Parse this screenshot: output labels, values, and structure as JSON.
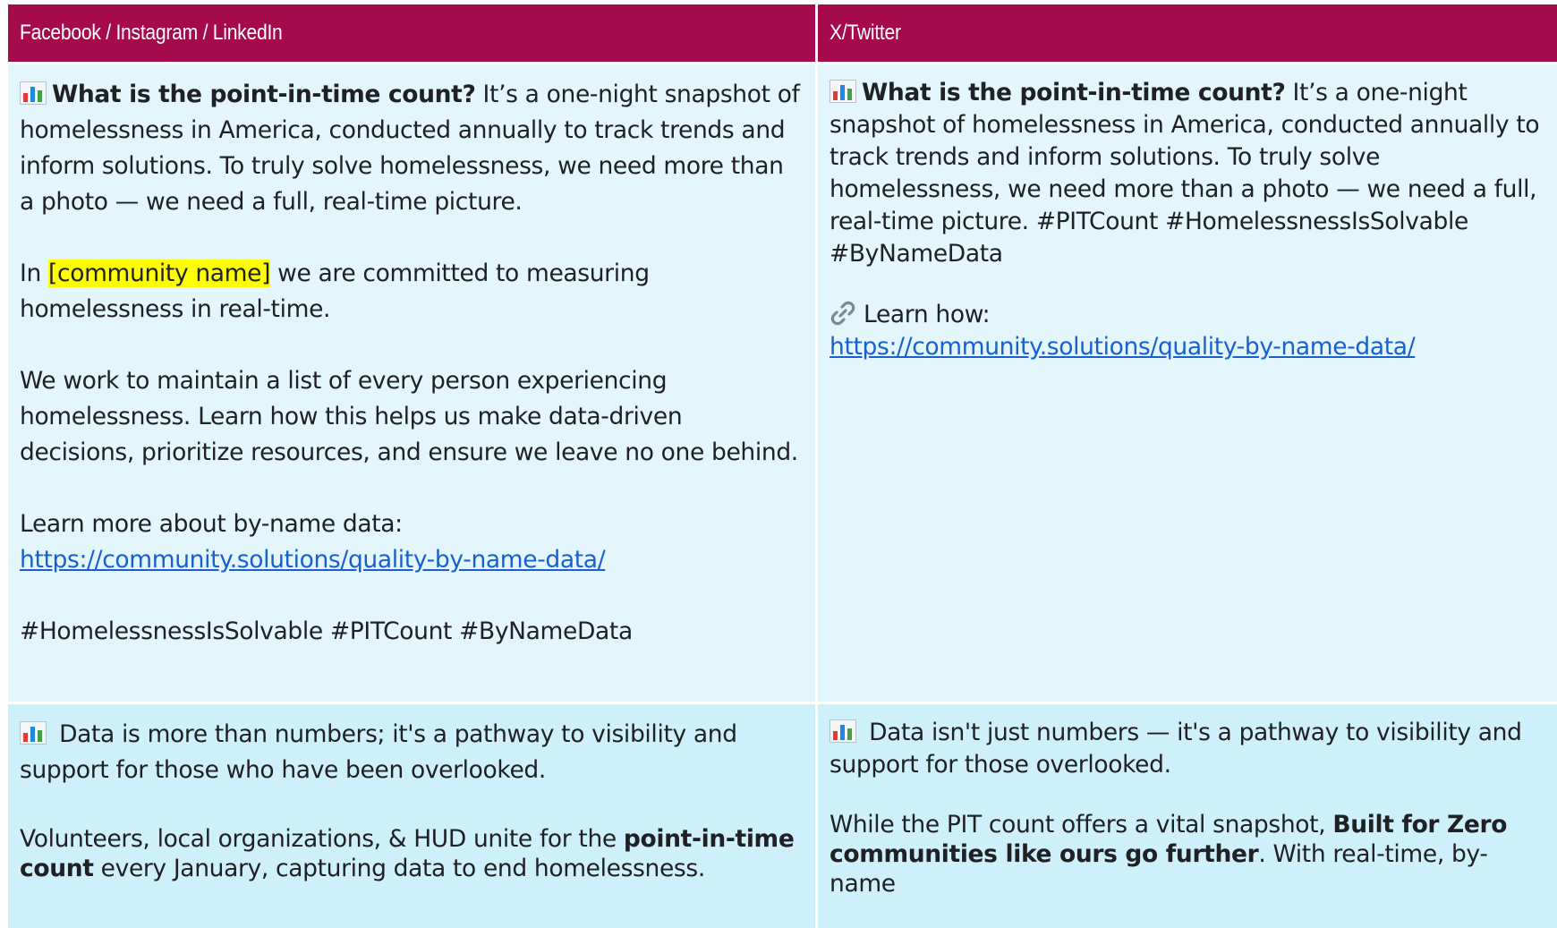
{
  "headers": {
    "left": "Facebook / Instagram / LinkedIn",
    "right": "X/Twitter"
  },
  "row1": {
    "left": {
      "q_bold": "What is the point-in-time count?",
      "q_rest": " It’s a one-night snapshot of homelessness in America, conducted annually to track trends and inform solutions. To truly solve homelessness, we need more than a photo — we need a full, real-time picture.",
      "p2_pre": "In ",
      "p2_placeholder": "[community name]",
      "p2_post": " we are committed to measuring homelessness in real-time.",
      "p3": "We work to maintain a list of every person experiencing homelessness. Learn how this helps us make data-driven decisions, prioritize resources, and ensure we leave no one behind.",
      "p4_label": "Learn more about by-name data:",
      "p4_link": "https://community.solutions/quality-by-name-data/",
      "p5": "#HomelessnessIsSolvable #PITCount #ByNameData"
    },
    "right": {
      "q_bold": "What is the point-in-time count?",
      "q_rest": " It’s a one-night snapshot of homelessness in America, conducted annually to track trends and inform solutions. To truly solve homelessness, we need more than a photo — we need a full, real-time picture. #PITCount #HomelessnessIsSolvable #ByNameData",
      "learn_label": "Learn how:",
      "link": "https://community.solutions/quality-by-name-data/"
    }
  },
  "row2": {
    "left": {
      "p1": " Data is more than numbers; it's a pathway to visibility and support for those who have been overlooked.",
      "p2_pre": "Volunteers, local organizations, & HUD unite for the ",
      "p2_bold": "point-in-time count",
      "p2_post": " every January, capturing data to end homelessness."
    },
    "right": {
      "p1": " Data isn't just numbers — it's a pathway to visibility and support for those overlooked.",
      "p2_pre": "While the PIT count offers a vital snapshot, ",
      "p2_bold": "Built for Zero communities like ours go further",
      "p2_post": ". With real-time, by-name"
    }
  },
  "colors": {
    "header_bg": "#a50b4c",
    "row1_bg": "#e2f6fc",
    "row2_bg": "#cef0fb",
    "highlight": "#ffff00",
    "link": "#1a5fd0"
  },
  "icons": {
    "chart": "bar-chart-icon",
    "link": "link-icon"
  }
}
